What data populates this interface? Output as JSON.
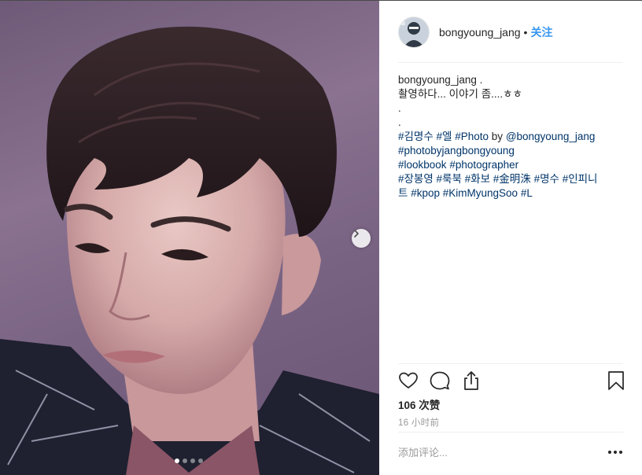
{
  "post": {
    "username": "bongyoung_jang",
    "dot": "•",
    "follow_label": "关注",
    "caption": {
      "username": "bongyoung_jang",
      "first_line_suffix": " .",
      "lines": [
        "촬영하다... 이야기 좀....ㅎㅎ",
        ".",
        "."
      ],
      "tag_lines": [
        [
          {
            "text": "#김명수",
            "type": "tag"
          },
          {
            "text": " ",
            "type": "text"
          },
          {
            "text": "#엘",
            "type": "tag"
          },
          {
            "text": " ",
            "type": "text"
          },
          {
            "text": "#Photo",
            "type": "tag"
          },
          {
            "text": " by ",
            "type": "text"
          },
          {
            "text": "@bongyoung_jang",
            "type": "tag"
          }
        ],
        [
          {
            "text": "#photobyjangbongyoung",
            "type": "tag"
          }
        ],
        [
          {
            "text": "#lookbook",
            "type": "tag"
          },
          {
            "text": " ",
            "type": "text"
          },
          {
            "text": "#photographer",
            "type": "tag"
          }
        ],
        [
          {
            "text": "#장봉영",
            "type": "tag"
          },
          {
            "text": " ",
            "type": "text"
          },
          {
            "text": "#룩북",
            "type": "tag"
          },
          {
            "text": " ",
            "type": "text"
          },
          {
            "text": "#화보",
            "type": "tag"
          },
          {
            "text": " ",
            "type": "text"
          },
          {
            "text": "#金明洙",
            "type": "tag"
          },
          {
            "text": " ",
            "type": "text"
          },
          {
            "text": "#명수",
            "type": "tag"
          },
          {
            "text": " ",
            "type": "text"
          },
          {
            "text": "#인피니",
            "type": "tag"
          }
        ],
        [
          {
            "text": "트",
            "type": "tag"
          },
          {
            "text": " ",
            "type": "text"
          },
          {
            "text": "#kpop",
            "type": "tag"
          },
          {
            "text": " ",
            "type": "text"
          },
          {
            "text": "#KimMyungSoo",
            "type": "tag"
          },
          {
            "text": " ",
            "type": "text"
          },
          {
            "text": "#L",
            "type": "tag"
          }
        ]
      ]
    },
    "likes_label": "106 次赞",
    "time_label": "16 小时前",
    "comment_placeholder": "添加评论...",
    "carousel": {
      "count": 4,
      "active_index": 0
    },
    "icons": {
      "like": "heart-icon",
      "comment": "comment-icon",
      "share": "share-icon",
      "save": "bookmark-icon",
      "more": "more-options-icon",
      "next": "chevron-right-icon"
    },
    "colors": {
      "link": "#003569",
      "follow": "#3897f0",
      "muted": "#999999",
      "text": "#262626"
    }
  }
}
